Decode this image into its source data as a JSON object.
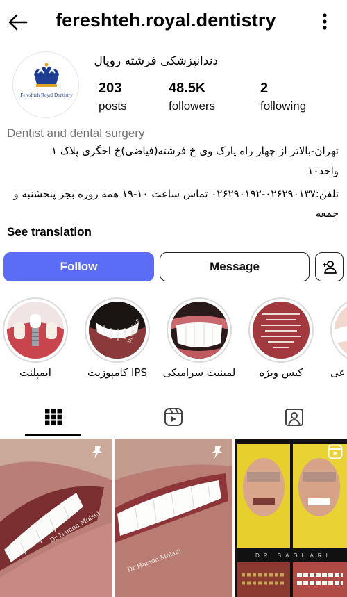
{
  "header": {
    "username": "fereshteh.royal.dentistry",
    "back_icon": "arrow-left-icon",
    "more_icon": "vertical-dots-icon"
  },
  "profile": {
    "avatar_text": "Fereshteh Royal Dentistry",
    "display_name": "دندانپزشکی فرشته رویال",
    "stats": [
      {
        "value": "203",
        "label": "posts"
      },
      {
        "value": "48.5K",
        "label": "followers"
      },
      {
        "value": "2",
        "label": "following"
      }
    ],
    "category": "Dentist and dental surgery",
    "bio_lines": [
      "تهران-بالاتر از چهار راه پارک وی خ فرشته(فیاضی)خ اخگری پلاک ۱",
      "واحد۱۰",
      "تلفن:۰۲۶۲۹۰۱۳۷-۰۲۶۲۹۰۱۹۲ تماس ساعت ۱۰-۱۹ همه روزه بجز پنجشنبه  و",
      "جمعه"
    ],
    "see_translation": "See translation"
  },
  "actions": {
    "follow": "Follow",
    "message": "Message",
    "suggest_icon": "add-person-icon"
  },
  "highlights": [
    {
      "label": "ایمپلنت"
    },
    {
      "label": "کامپوزیت IPS"
    },
    {
      "label": "لمینیت سرامیکی"
    },
    {
      "label": "کیس ویژه"
    },
    {
      "label": "عی"
    }
  ],
  "tabs": [
    {
      "name": "posts-grid",
      "icon": "grid-icon",
      "active": true
    },
    {
      "name": "reels",
      "icon": "reels-icon",
      "active": false
    },
    {
      "name": "tagged",
      "icon": "tagged-user-icon",
      "active": false
    }
  ],
  "posts": [
    {
      "watermark": "Dr Hamon Molaei",
      "pinned": true
    },
    {
      "watermark": "Dr Hamon Molaei",
      "pinned": true
    },
    {
      "watermark": "DR SAGHARI",
      "pinned": false
    }
  ],
  "colors": {
    "follow_button": "#5b6cf7",
    "secondary_text": "#737373",
    "logo_blue": "#1f3f95",
    "logo_gold": "#e0a526"
  }
}
